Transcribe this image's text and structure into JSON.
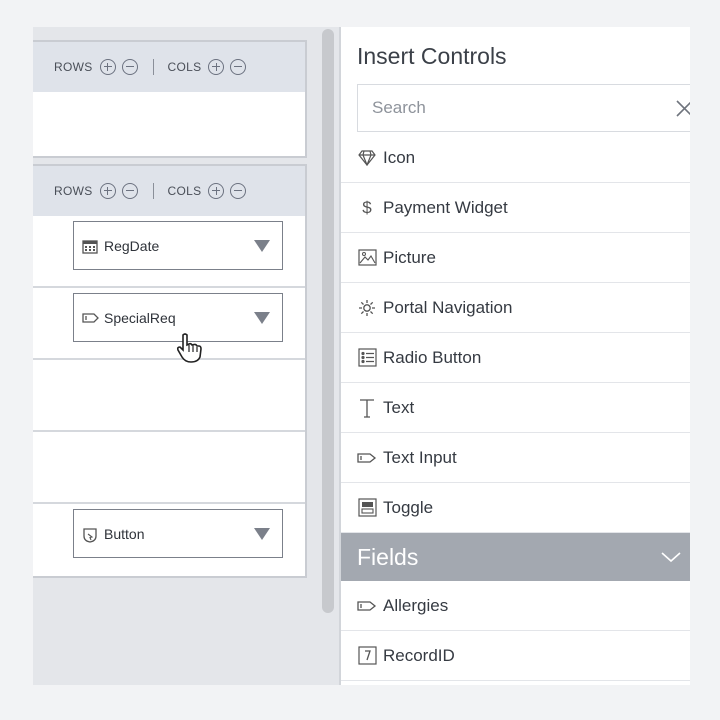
{
  "canvas": {
    "section1": {
      "rows_label": "ROWS",
      "cols_label": "COLS"
    },
    "section2": {
      "rows_label": "ROWS",
      "cols_label": "COLS",
      "rows": [
        {
          "control": "RegDate",
          "icon": "calendar-icon"
        },
        {
          "control": "SpecialReq",
          "icon": "text-input-icon"
        },
        {
          "control": ""
        },
        {
          "control": ""
        },
        {
          "control": "Button",
          "icon": "button-icon"
        }
      ]
    }
  },
  "panel": {
    "title": "Insert Controls",
    "search": {
      "placeholder": "Search",
      "value": ""
    },
    "items": [
      {
        "label": "Icon",
        "icon": "gem-icon"
      },
      {
        "label": "Payment Widget",
        "icon": "dollar-icon"
      },
      {
        "label": "Picture",
        "icon": "picture-icon"
      },
      {
        "label": "Portal Navigation",
        "icon": "portal-icon"
      },
      {
        "label": "Radio Button",
        "icon": "radio-list-icon"
      },
      {
        "label": "Text",
        "icon": "text-icon"
      },
      {
        "label": "Text Input",
        "icon": "text-input-icon"
      },
      {
        "label": "Toggle",
        "icon": "toggle-icon"
      }
    ],
    "fields_header": "Fields",
    "fields": [
      {
        "label": "Allergies",
        "icon": "text-input-icon"
      },
      {
        "label": "RecordID",
        "icon": "record-id-icon"
      }
    ]
  },
  "colors": {
    "header_bg": "#dfe3ea",
    "fields_bar": "#a3a8b0",
    "border": "#c9ccd2"
  }
}
